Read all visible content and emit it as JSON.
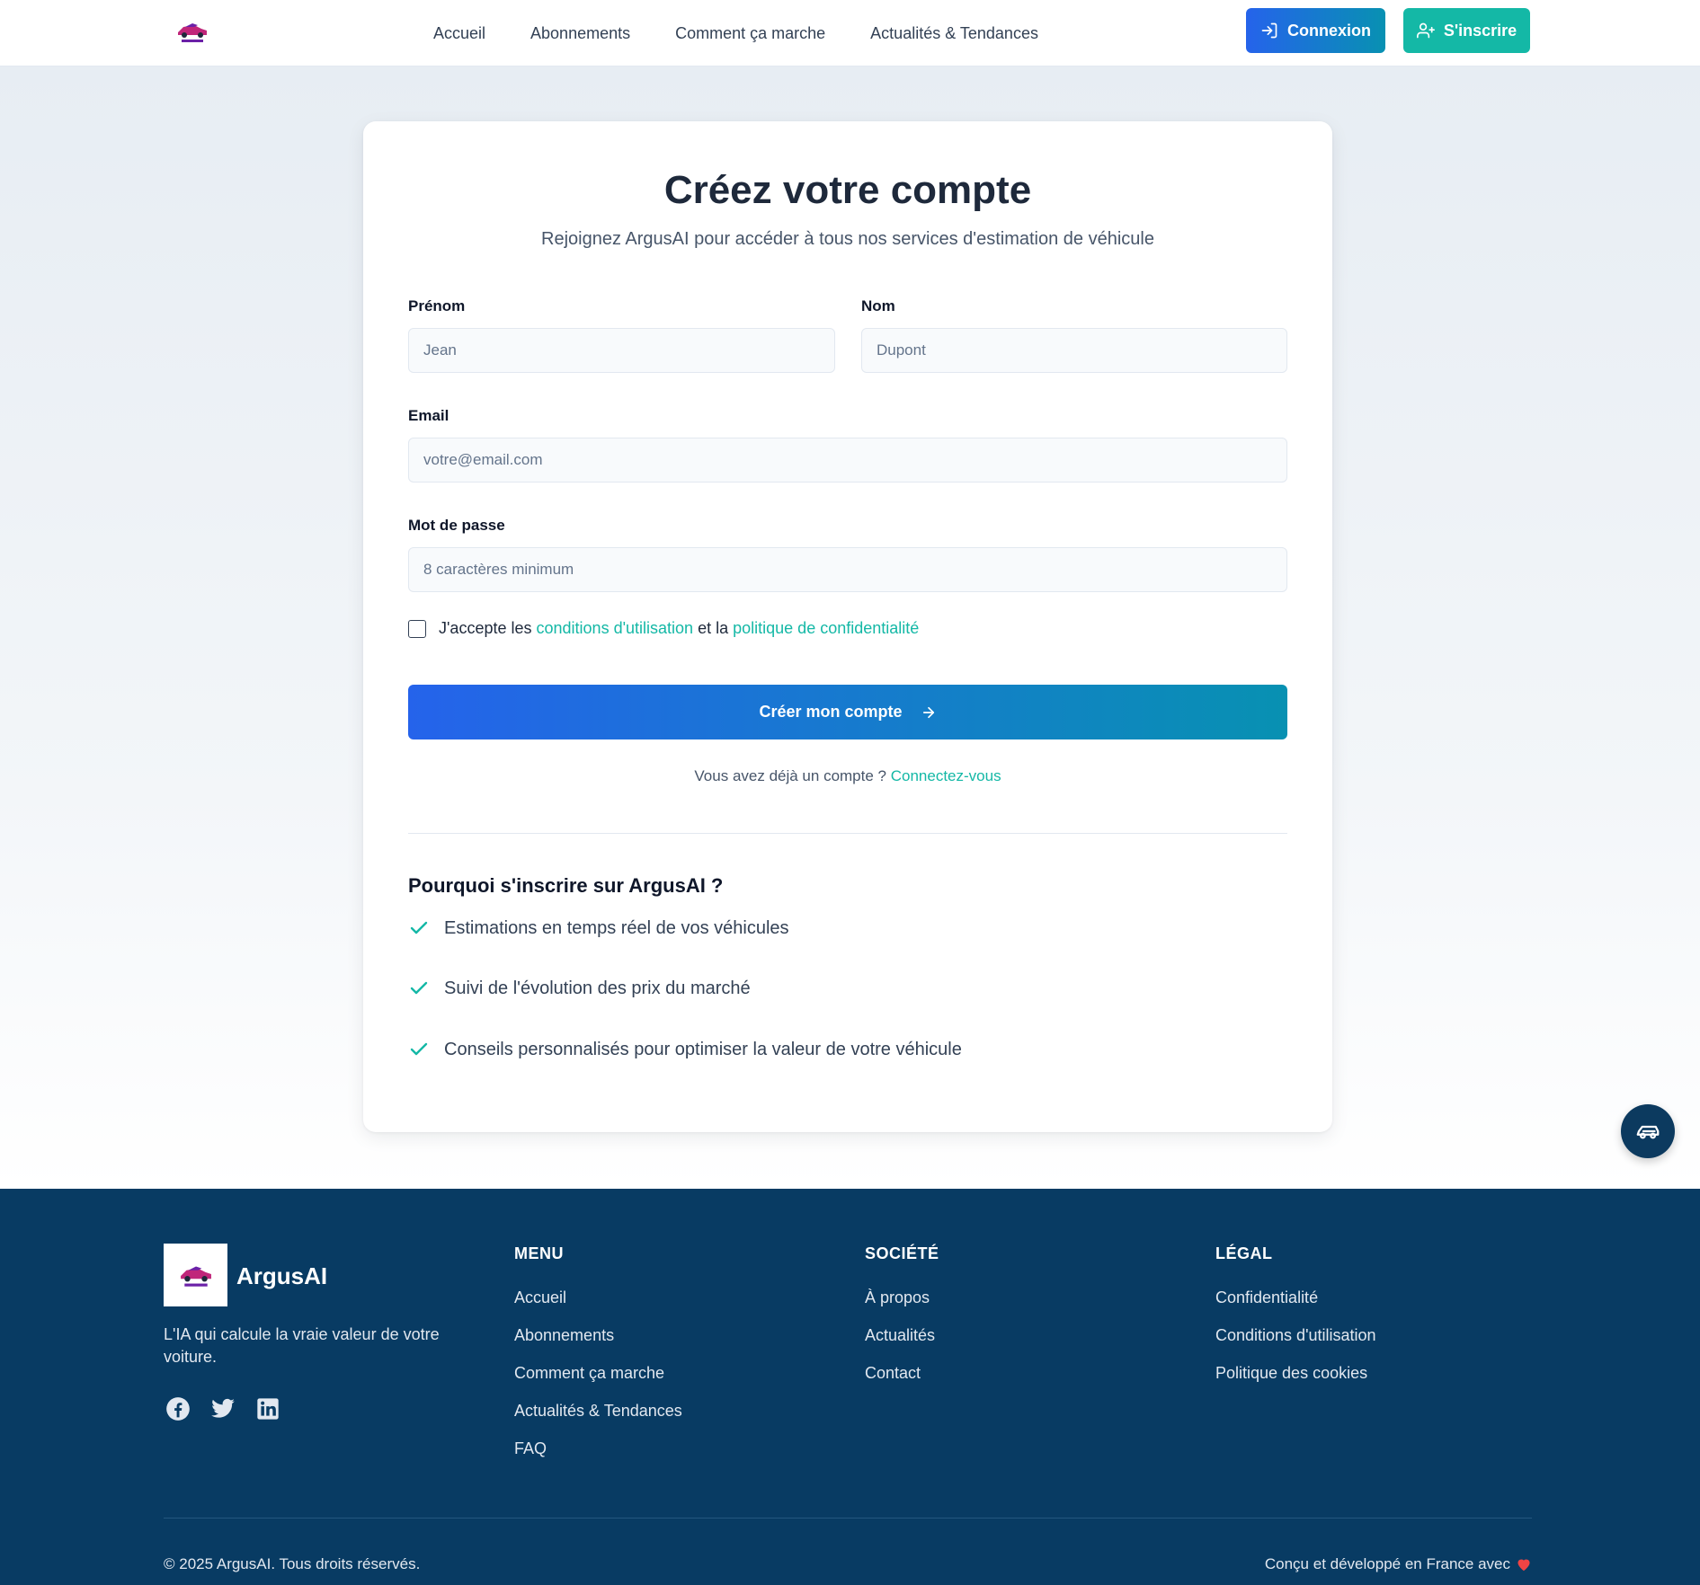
{
  "header": {
    "nav": [
      "Accueil",
      "Abonnements",
      "Comment ça marche",
      "Actualités & Tendances"
    ],
    "login_label": "Connexion",
    "signup_label": "S'inscrire"
  },
  "form": {
    "title": "Créez votre compte",
    "subtitle": "Rejoignez ArgusAI pour accéder à tous nos services d'estimation de véhicule",
    "first_name": {
      "label": "Prénom",
      "placeholder": "Jean"
    },
    "last_name": {
      "label": "Nom",
      "placeholder": "Dupont"
    },
    "email": {
      "label": "Email",
      "placeholder": "votre@email.com"
    },
    "password": {
      "label": "Mot de passe",
      "placeholder": "8 caractères minimum"
    },
    "terms": {
      "prefix": "J'accepte les",
      "conditions_link": "conditions d'utilisation",
      "middle": "et la",
      "privacy_link": "politique de confidentialité"
    },
    "submit_label": "Créer mon compte",
    "login_prompt": "Vous avez déjà un compte ?",
    "login_link": "Connectez-vous"
  },
  "why": {
    "title": "Pourquoi s'inscrire sur ArgusAI ?",
    "items": [
      "Estimations en temps réel de vos véhicules",
      "Suivi de l'évolution des prix du marché",
      "Conseils personnalisés pour optimiser la valeur de votre véhicule"
    ]
  },
  "footer": {
    "brand": "ArgusAI",
    "tagline": "L'IA qui calcule la vraie valeur de votre voiture.",
    "social_icons": [
      "facebook-icon",
      "twitter-icon",
      "linkedin-icon"
    ],
    "menu": {
      "title": "MENU",
      "links": [
        "Accueil",
        "Abonnements",
        "Comment ça marche",
        "Actualités & Tendances",
        "FAQ"
      ]
    },
    "company": {
      "title": "SOCIÉTÉ",
      "links": [
        "À propos",
        "Actualités",
        "Contact"
      ]
    },
    "legal": {
      "title": "LÉGAL",
      "links": [
        "Confidentialité",
        "Conditions d'utilisation",
        "Politique des cookies"
      ]
    },
    "copyright": "© 2025 ArgusAI. Tous droits réservés.",
    "made_in": "Conçu et développé en France avec"
  },
  "colors": {
    "primary_blue": "#2563eb",
    "teal": "#14b8a6",
    "footer_bg": "#083b63"
  }
}
